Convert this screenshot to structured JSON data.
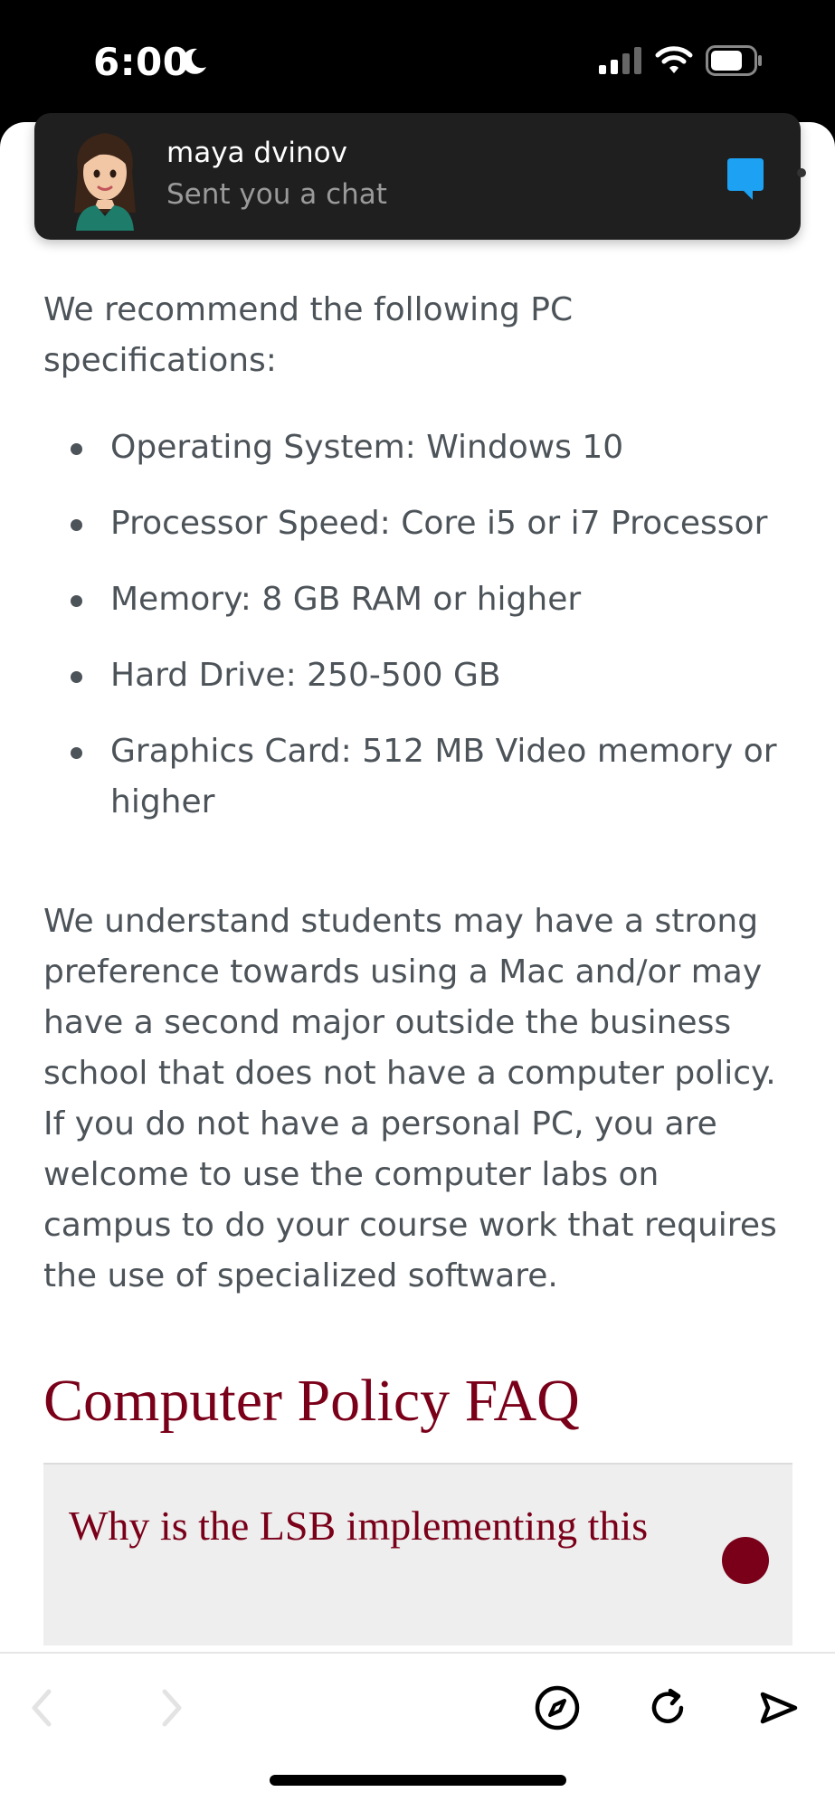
{
  "status_bar": {
    "time": "6:00"
  },
  "notification": {
    "sender": "maya dvinov",
    "message": "Sent you a chat",
    "accent_color": "#1da1f2"
  },
  "content": {
    "intro": "We recommend the following PC specifications:",
    "specs": [
      "Operating System: Windows 10",
      "Processor Speed: Core i5 or i7 Processor",
      "Memory: 8 GB RAM or higher",
      "Hard Drive: 250-500 GB",
      "Graphics Card: 512 MB Video memory or higher"
    ],
    "paragraph": "We understand students may have a strong preference towards using a Mac and/or may have a second major outside the business school that does not have a computer policy. If you do not have a personal PC, you are welcome to use the computer labs on campus to do your course work that requires the use of specialized software.",
    "faq_heading": "Computer Policy FAQ",
    "faq_question": "Why is the LSB implementing this",
    "brand_color": "#7a0019"
  },
  "toolbar": {
    "icons": [
      "back-arrow-icon",
      "forward-arrow-icon",
      "compass-icon",
      "reload-icon",
      "share-icon"
    ]
  }
}
